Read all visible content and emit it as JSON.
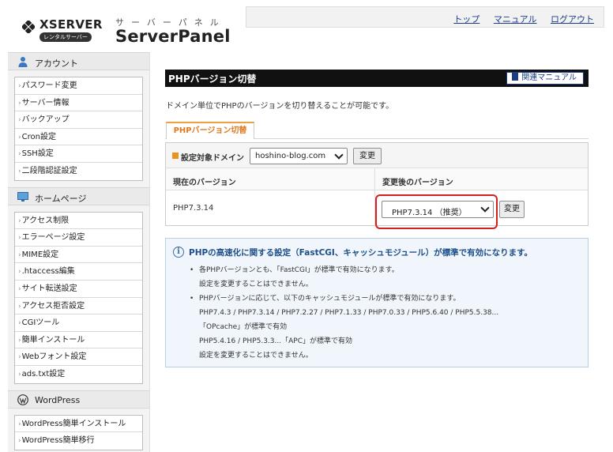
{
  "header": {
    "brand": "XSERVER",
    "brand_badge": "レンタルサーバー",
    "product_kana": "サーバーパネル",
    "product_name": "ServerPanel",
    "links": [
      "トップ",
      "マニュアル",
      "ログアウト"
    ]
  },
  "sidebar": {
    "sections": [
      {
        "title": "アカウント",
        "icon": "user-icon",
        "items": [
          "パスワード変更",
          "サーバー情報",
          "バックアップ",
          "Cron設定",
          "SSH設定",
          "二段階認証設定"
        ]
      },
      {
        "title": "ホームページ",
        "icon": "monitor-icon",
        "items": [
          "アクセス制限",
          "エラーページ設定",
          "MIME設定",
          ".htaccess編集",
          "サイト転送設定",
          "アクセス拒否設定",
          "CGIツール",
          "簡単インストール",
          "Webフォント設定",
          "ads.txt設定"
        ]
      },
      {
        "title": "WordPress",
        "icon": "wordpress-icon",
        "items": [
          "WordPress簡単インストール",
          "WordPress簡単移行"
        ]
      }
    ]
  },
  "main": {
    "title": "PHPバージョン切替",
    "manual_button": "関連マニュアル",
    "description": "ドメイン単位でPHPのバージョンを切り替えることが可能です。",
    "tab": "PHPバージョン切替",
    "domain_label": "設定対象ドメイン",
    "domain_value": "hoshino-blog.com",
    "change_label": "変更",
    "col_current": "現在のバージョン",
    "col_after": "変更後のバージョン",
    "current_version": "PHP7.3.14",
    "new_version_value": "PHP7.3.14 （推奨）",
    "info": {
      "title": "PHPの高速化に関する設定（FastCGI、キャッシュモジュール）が標準で有効になります。",
      "bullet1": "各PHPバージョンとも、「FastCGI」が標準で有効になります。",
      "bullet1_sub": "設定を変更することはできません。",
      "bullet2": "PHPバージョンに応じて、以下のキャッシュモジュールが標準で有効になります。",
      "versions_a": "PHP7.4.3 / PHP7.3.14 / PHP7.2.27 / PHP7.1.33 / PHP7.0.33 / PHP5.6.40 / PHP5.5.38...",
      "cache_a": "「OPcache」が標準で有効",
      "versions_b": "PHP5.4.16 / PHP5.3.3...「APC」が標準で有効",
      "bullet2_sub": "設定を変更することはできません。"
    }
  },
  "colors": {
    "title_bar": "#111111",
    "tab_accent": "#e07a1f",
    "link": "#1a3e8c",
    "highlight": "#d21f1f",
    "info_title": "#1d4f8a"
  }
}
